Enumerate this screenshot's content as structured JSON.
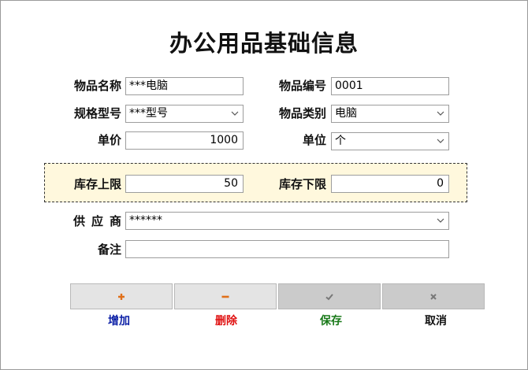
{
  "window": {
    "title": "办公用品基础信息"
  },
  "form": {
    "item_name": {
      "label": "物品名称",
      "value": "***电脑"
    },
    "item_code": {
      "label": "物品编号",
      "value": "0001"
    },
    "spec_model": {
      "label": "规格型号",
      "value": "***型号"
    },
    "category": {
      "label": "物品类别",
      "value": "电脑"
    },
    "unit_price": {
      "label": "单价",
      "value": "1000"
    },
    "unit": {
      "label": "单位",
      "value": "个"
    },
    "stock_max": {
      "label": "库存上限",
      "value": "50"
    },
    "stock_min": {
      "label": "库存下限",
      "value": "0"
    },
    "supplier": {
      "label": "供应商",
      "value": "******"
    },
    "remark": {
      "label": "备注",
      "value": ""
    }
  },
  "actions": {
    "add": {
      "label": "增加",
      "icon": "plus-icon",
      "color": "#0b1fa6",
      "icon_color": "#e0701a"
    },
    "delete": {
      "label": "删除",
      "icon": "minus-icon",
      "color": "#e01010",
      "icon_color": "#e0701a"
    },
    "save": {
      "label": "保存",
      "icon": "check-icon",
      "color": "#1a7a1a",
      "icon_color": "#777777"
    },
    "cancel": {
      "label": "取消",
      "icon": "cross-icon",
      "color": "#111111",
      "icon_color": "#777777"
    }
  },
  "colors": {
    "stock_panel_bg": "#fff8dd",
    "button_bg": "#e4e4e4",
    "button_disabled_bg": "#cbcbcb"
  }
}
